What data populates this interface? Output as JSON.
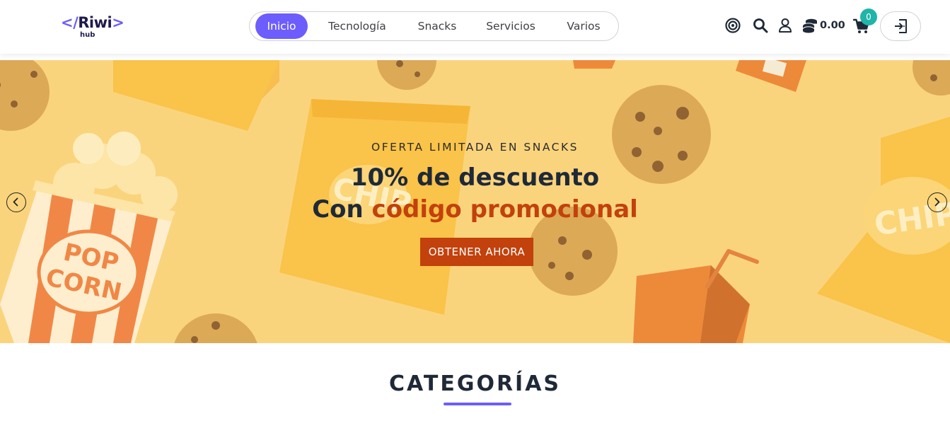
{
  "brand": {
    "logo_main": "Riwi",
    "logo_open": "</",
    "logo_close": ">",
    "logo_sub": "hub"
  },
  "nav": {
    "items": [
      {
        "label": "Inicio",
        "active": true
      },
      {
        "label": "Tecnología",
        "active": false
      },
      {
        "label": "Snacks",
        "active": false
      },
      {
        "label": "Servicios",
        "active": false
      },
      {
        "label": "Varios",
        "active": false
      }
    ]
  },
  "header_actions": {
    "icons": [
      "target-icon",
      "search-icon",
      "user-icon",
      "coins-icon",
      "cart-icon",
      "login-icon"
    ],
    "coins_balance": "0.00",
    "cart_count": "0"
  },
  "hero": {
    "eyebrow": "OFERTA LIMITADA EN SNACKS",
    "headline_line1": "10% de descuento",
    "headline_line2_prefix": "Con ",
    "headline_line2_accent": "código promocional",
    "cta_label": "OBTENER AHORA",
    "prev_icon": "chevron-left-icon",
    "next_icon": "chevron-right-icon"
  },
  "categories": {
    "title": "CATEGORÍAS"
  },
  "colors": {
    "accent": "#6d5dfc",
    "promo": "#c2410c",
    "badge": "#1fb5a8",
    "hero_bg": "#fbd57d"
  }
}
